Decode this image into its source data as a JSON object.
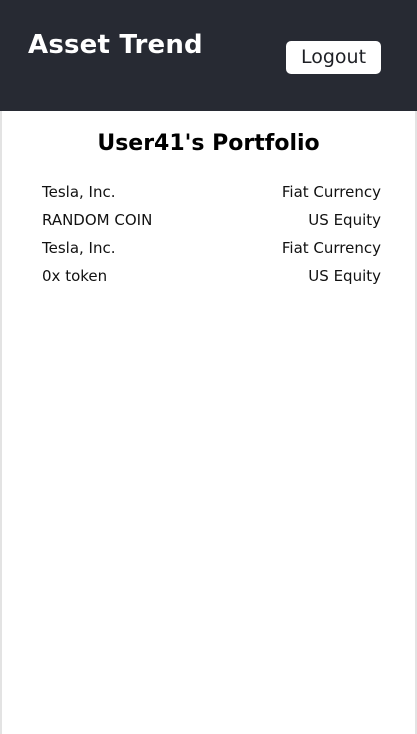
{
  "header": {
    "title": "Asset Trend",
    "logout_label": "Logout"
  },
  "portfolio": {
    "title": "User41's Portfolio",
    "holdings": [
      {
        "name": "Tesla, Inc.",
        "type": "Fiat Currency"
      },
      {
        "name": "RANDOM COIN",
        "type": "US Equity"
      },
      {
        "name": "Tesla, Inc.",
        "type": "Fiat Currency"
      },
      {
        "name": "0x token",
        "type": "US Equity"
      }
    ]
  },
  "colors": {
    "header_bg": "#272a33",
    "header_text": "#ffffff",
    "button_bg": "#ffffff"
  }
}
